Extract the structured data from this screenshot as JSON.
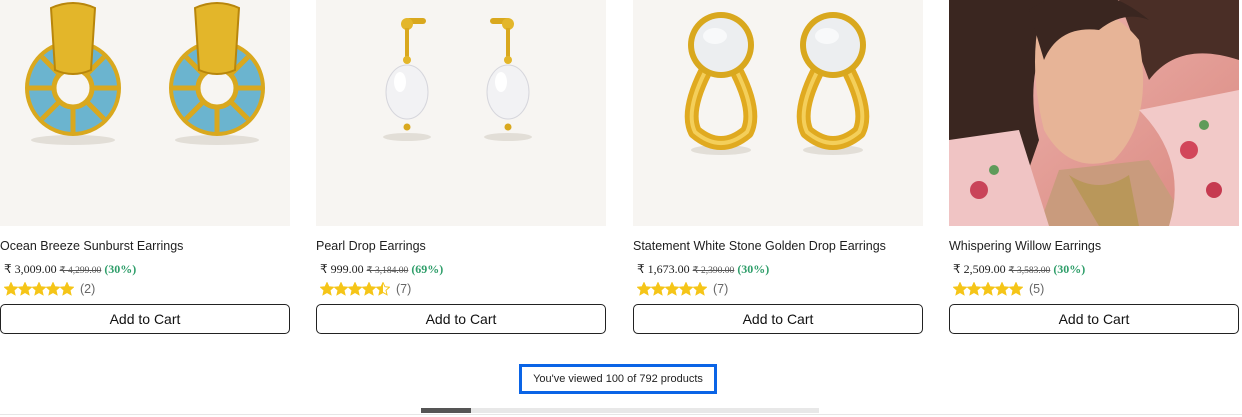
{
  "products": [
    {
      "name": "Ocean Breeze Sunburst Earrings",
      "price": "₹ 3,009.00",
      "mrp": "₹ 4,299.00",
      "discount": "(30%)",
      "rating": 5,
      "reviews": "(2)",
      "cart_label": "Add to Cart",
      "image": "blue-gold-earrings"
    },
    {
      "name": "Pearl Drop Earrings",
      "price": "₹ 999.00",
      "mrp": "₹ 3,184.00",
      "discount": "(69%)",
      "rating": 4.5,
      "reviews": "(7)",
      "cart_label": "Add to Cart",
      "image": "pearl-drop-earrings"
    },
    {
      "name": "Statement White Stone Golden Drop Earrings",
      "price": "₹ 1,673.00",
      "mrp": "₹ 2,390.00",
      "discount": "(30%)",
      "rating": 5,
      "reviews": "(7)",
      "cart_label": "Add to Cart",
      "image": "white-stone-gold-earrings"
    },
    {
      "name": "Whispering Willow Earrings",
      "price": "₹ 2,509.00",
      "mrp": "₹ 3,583.00",
      "discount": "(30%)",
      "rating": 5,
      "reviews": "(5)",
      "cart_label": "Add to Cart",
      "image": "model-photo"
    }
  ],
  "pagination": {
    "viewed_text": "You've viewed 100 of 792 products",
    "progress": 0.126
  },
  "colors": {
    "star": "#f5c518",
    "discount": "#2f9e6a",
    "highlight": "#0a64e6",
    "gold": "#d9a81e"
  }
}
